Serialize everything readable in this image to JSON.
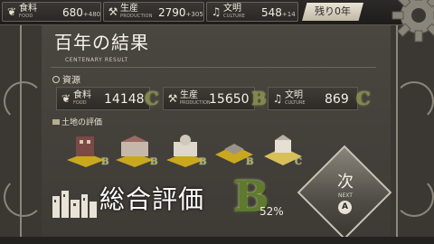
{
  "top_bar": {
    "food": {
      "label": "食料",
      "sub": "FOOD",
      "value": "680",
      "delta": "+480"
    },
    "production": {
      "label": "生産",
      "sub": "PRODUCTION",
      "value": "2790",
      "delta": "+305"
    },
    "culture": {
      "label": "文明",
      "sub": "CULTURE",
      "value": "548",
      "delta": "+14"
    },
    "remaining": "残り0年"
  },
  "result": {
    "title": "百年の結果",
    "subtitle": "CENTENARY RESULT",
    "resources_heading": "資源",
    "resources": [
      {
        "label": "食料",
        "sub": "FOOD",
        "value": "14148",
        "grade": "C"
      },
      {
        "label": "生産",
        "sub": "PRODUCTION",
        "value": "15650",
        "grade": "B"
      },
      {
        "label": "文明",
        "sub": "CULTURE",
        "value": "869",
        "grade": "C"
      }
    ],
    "land_heading": "土地の評価",
    "land_grades": [
      "B",
      "B",
      "B",
      "B",
      "C"
    ],
    "total_label": "総合評価",
    "total_grade": "B",
    "total_percent": "52%"
  },
  "next_button": {
    "label": "次",
    "sub": "NEXT",
    "key": "A"
  },
  "icons": {
    "food": "wheat-icon",
    "production": "hammer-icon",
    "culture": "scroll-icon",
    "land": "tile-icon",
    "total": "city-skyline-icon",
    "gear": "gear-icon"
  },
  "colors": {
    "grade": "#7f8a46",
    "total_grade": "#5e7a2c",
    "panel": "#3e3a35"
  }
}
